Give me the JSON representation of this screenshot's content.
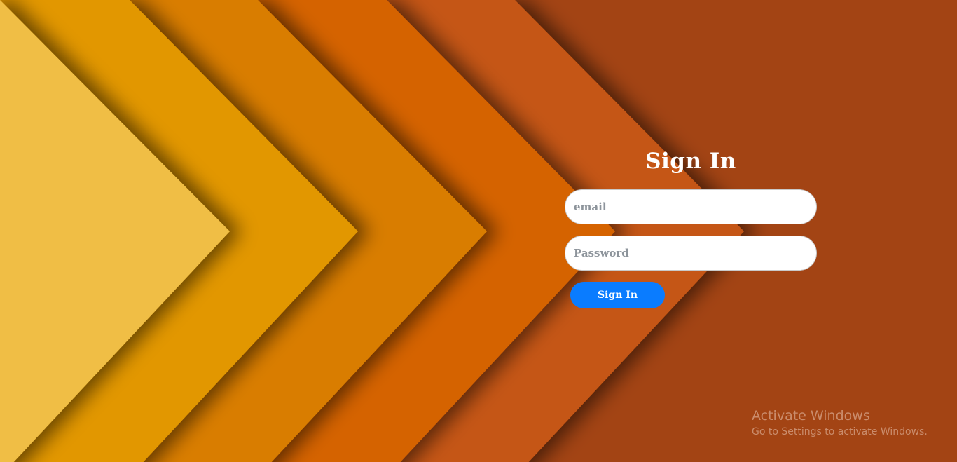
{
  "colors": {
    "background": "#a34414",
    "chevrons": [
      "#c55713",
      "#d56303",
      "#d97d00",
      "#e29700",
      "#f0be45"
    ],
    "button": "#0a7cff",
    "title_text": "#ffffff"
  },
  "signin": {
    "title": "Sign In",
    "email_placeholder": "email",
    "password_placeholder": "Password",
    "button_label": "Sign In"
  },
  "watermark": {
    "title": "Activate Windows",
    "subtitle": "Go to Settings to activate Windows."
  }
}
